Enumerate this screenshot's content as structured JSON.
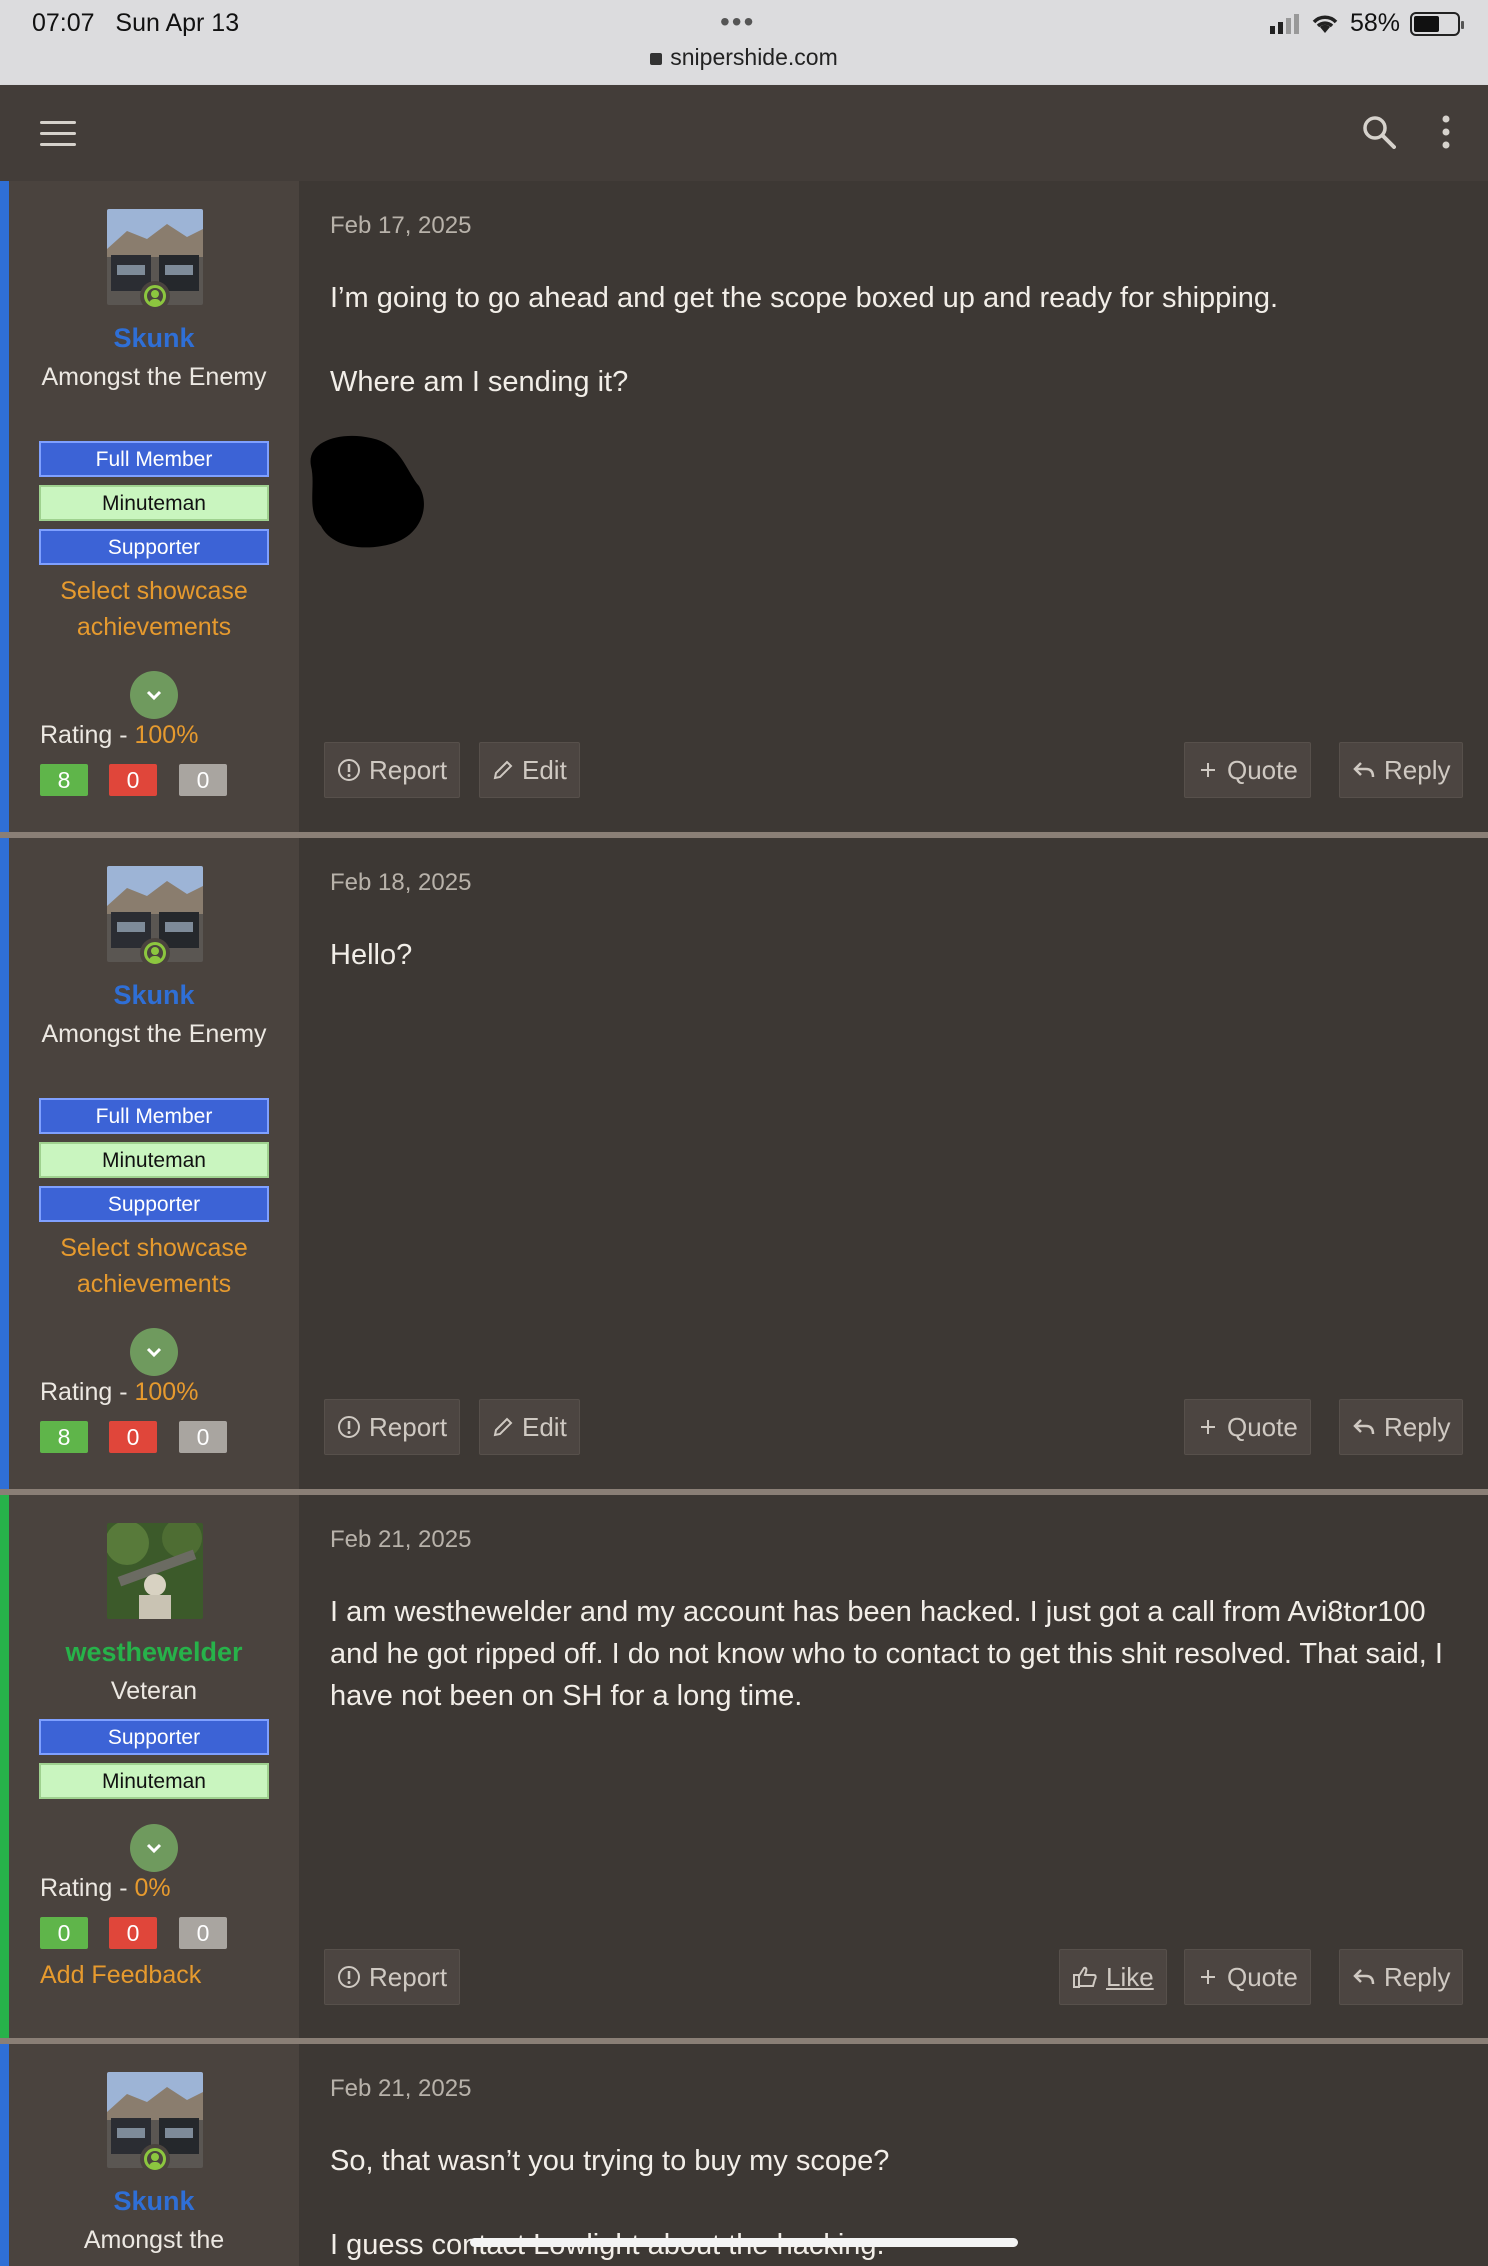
{
  "status_bar": {
    "time": "07:07",
    "date": "Sun Apr 13",
    "battery": "58%",
    "url": "snipershide.com"
  },
  "colors": {
    "accent_orange": "#e69a2e",
    "skunk_name": "#2f6fd6",
    "west_name": "#27b24a",
    "rank_blue": "#3c63d6",
    "rank_green": "#c9f5bf"
  },
  "buttons": {
    "report": "Report",
    "edit": "Edit",
    "quote": "Quote",
    "reply": "Reply",
    "like": "Like"
  },
  "rating_label": "Rating - ",
  "posts": [
    {
      "user": "Skunk",
      "title": "Amongst the Enemy",
      "badges": [
        "Full Member",
        "Minuteman",
        "Supporter"
      ],
      "showcase": "Select showcase achievements",
      "rating_pct": "100%",
      "ratings": [
        "8",
        "0",
        "0"
      ],
      "date": "Feb 17, 2025",
      "body": [
        "I’m going to go ahead and get the scope boxed up and ready for shipping.",
        "Where am I sending it?"
      ]
    },
    {
      "user": "Skunk",
      "title": "Amongst the Enemy",
      "badges": [
        "Full Member",
        "Minuteman",
        "Supporter"
      ],
      "showcase": "Select showcase achievements",
      "rating_pct": "100%",
      "ratings": [
        "8",
        "0",
        "0"
      ],
      "date": "Feb 18, 2025",
      "body": [
        "Hello?"
      ]
    },
    {
      "user": "westhewelder",
      "title": "Veteran",
      "badges": [
        "Supporter",
        "Minuteman"
      ],
      "rating_pct": "0%",
      "ratings": [
        "0",
        "0",
        "0"
      ],
      "add_feedback": "Add Feedback",
      "date": "Feb 21, 2025",
      "body": [
        "I am westhewelder and my account has been hacked. I just got a call from Avi8tor100 and he got ripped off. I do not know who to contact to get this shit resolved. That said, I have not been on SH for a long time."
      ]
    },
    {
      "user": "Skunk",
      "title": "Amongst the",
      "date": "Feb 21, 2025",
      "body": [
        "So, that wasn’t you trying to buy my scope?",
        "I guess contact Lowlight about the hacking."
      ]
    }
  ]
}
